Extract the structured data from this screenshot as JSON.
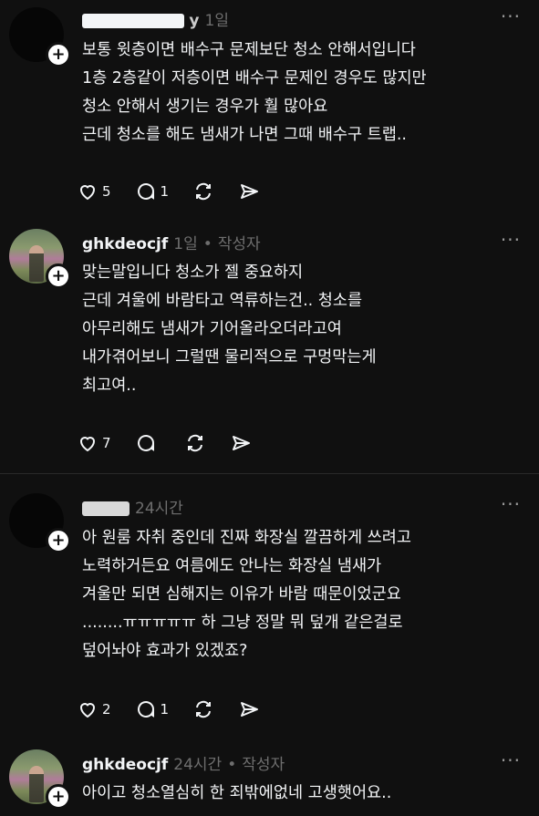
{
  "posts": [
    {
      "author": "",
      "time": "1일",
      "author_badge": "",
      "lines": [
        "보통 윗층이면 배수구 문제보단 청소 안해서입니다",
        "1층 2층같이 저층이면 배수구 문제인 경우도 많지만",
        "청소 안해서 생기는 경우가 훨 많아요",
        "근데 청소를 해도 냄새가 나면 그때 배수구 트랩.."
      ],
      "likes": "5",
      "replies": "1"
    },
    {
      "author": "ghkdeocjf",
      "time": "1일",
      "author_badge": "작성자",
      "lines": [
        "맞는말입니다 청소가 젤 중요하지",
        "근데 겨울에 바람타고 역류하는건.. 청소를",
        "아무리해도 냄새가 기어올라오더라고여",
        "내가겪어보니 그럴땐 물리적으로 구멍막는게",
        "최고여.."
      ],
      "likes": "7",
      "replies": ""
    },
    {
      "author": "",
      "time": "24시간",
      "author_badge": "",
      "lines": [
        "아 원룸 자취 중인데 진짜 화장실 깔끔하게 쓰려고",
        "노력하거든요 여름에도 안나는 화장실 냄새가",
        "겨울만 되면 심해지는 이유가 바람 때문이었군요",
        "........ㅠㅠㅠㅠㅠ 하 그냥 정말 뭐 덮개 같은걸로",
        "덮어놔야 효과가 있겠죠?"
      ],
      "likes": "2",
      "replies": "1"
    },
    {
      "author": "ghkdeocjf",
      "time": "24시간",
      "author_badge": "작성자",
      "lines": [
        "아이고 청소열심히 한 죄밖에없네 고생햇어요.."
      ],
      "likes": "",
      "replies": ""
    }
  ],
  "ui": {
    "more_glyph": "···",
    "separator": "•",
    "plus_glyph": "+"
  },
  "icons": {
    "like": "heart-icon",
    "reply": "comment-icon",
    "repost": "repost-icon",
    "share": "share-icon"
  }
}
